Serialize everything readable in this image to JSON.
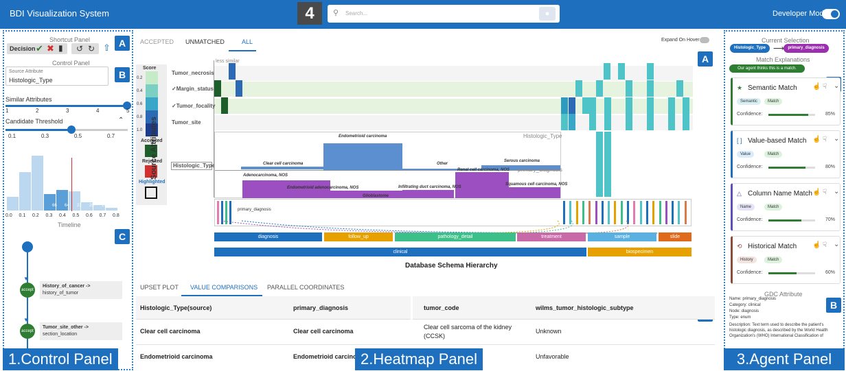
{
  "header": {
    "title": "BDI Visualization System",
    "marker": "4",
    "search_placeholder": "Search...",
    "developer_mode": "Developer Mode"
  },
  "panel_labels": {
    "control": "1.Control Panel",
    "heatmap": "2.Heatmap Panel",
    "agent": "3.Agent Panel"
  },
  "badges": {
    "a": "A",
    "b": "B",
    "c": "C"
  },
  "control": {
    "shortcut_title": "Shortcut Panel",
    "decision": "Decision",
    "control_title": "Control Panel",
    "source_attr_label": "Source Attribute",
    "source_attr_value": "Histologic_Type",
    "similar_label": "Similar Attributes",
    "similar_ticks": [
      "1",
      "2",
      "3",
      "4",
      "5"
    ],
    "threshold_label": "Candidate Threshold",
    "threshold_ticks": [
      "0.1",
      "0.3",
      "0.5",
      "0.7"
    ],
    "hist_values": [
      "66",
      "64",
      "21",
      "25",
      "17"
    ],
    "hist_axis": [
      "0.0",
      "0.1",
      "0.2",
      "0.3",
      "0.4",
      "0.5",
      "0.6",
      "0.7",
      "0.8"
    ],
    "timeline_label": "Timeline",
    "timeline": [
      {
        "badge": "accept",
        "title": "History_of_cancer ->",
        "sub": "history_of_tumor"
      },
      {
        "badge": "accept",
        "title": "Tumor_site_other ->",
        "sub": "section_location"
      }
    ]
  },
  "heatmap": {
    "tabs": [
      "ACCEPTED",
      "UNMATCHED",
      "ALL"
    ],
    "active_tab": "ALL",
    "expand_label": "Expand On Hover",
    "legend": {
      "score": "Score",
      "ticks": [
        "0.2",
        "0.4",
        "0.6",
        "0.8",
        "1.0"
      ],
      "accepted": "Accepted",
      "rejected": "Rejected",
      "highlighted": "Highlighted",
      "accent": "#1e5e2a",
      "reject": "#d32f2f"
    },
    "y_title": "Source Attributes",
    "less_similar": "less similar",
    "rows": [
      "Tumor_necrosis",
      "✓Margin_status",
      "✓Tumor_focality",
      "Tumor_site"
    ],
    "hist_row": "Histologic_Type",
    "dist_labels": [
      "Endometrioid carcinoma",
      "Clear cell carcinoma",
      "Other",
      "Serous carcinoma",
      "Histologic_Type",
      "Renal cell carcinoma, NOS",
      "primary_diagnosis",
      "Adenocarcinoma, NOS",
      "Endometrioid adenocarcinoma, NOS",
      "Glioblastome",
      "Infiltrating duct carcinoma, NOS",
      "Squamous cell carcinoma, NOS"
    ],
    "primary_label": "primary_diagnosis",
    "hierarchy_l1": [
      "diagnosis",
      "follow_up",
      "pathology_detail",
      "treatment",
      "sample",
      "slide"
    ],
    "hierarchy_l2": [
      "clinical",
      "biospecimen"
    ],
    "hierarchy_title": "Database Schema Hierarchy"
  },
  "lower": {
    "tabs": [
      "UPSET PLOT",
      "VALUE COMPARISONS",
      "PARALLEL COORDINATES"
    ],
    "columns": [
      "Histologic_Type(source)",
      "primary_diagnosis",
      "tumor_code",
      "wilms_tumor_histologic_subtype"
    ],
    "rows": [
      [
        "Clear cell carcinoma",
        "Clear cell carcinoma",
        "Clear cell sarcoma of the kidney (CCSK)",
        "Unknown"
      ],
      [
        "Endometrioid carcinoma",
        "Endometrioid carcinoma",
        "",
        "Unfavorable"
      ]
    ]
  },
  "agent": {
    "current_title": "Current Selection",
    "source_chip": "Histologic_Type",
    "target_chip": "primary_diagnosis",
    "explanations_title": "Match Explanations",
    "agent_msg": "Our agent thinks this is a match.",
    "cards": [
      {
        "title": "Semantic Match",
        "tags": [
          "Semantic",
          "Match"
        ],
        "confidence": "Confidence:",
        "pct": "85%",
        "value": 0.85,
        "color": "#2e7d32"
      },
      {
        "title": "Value-based Match",
        "tags": [
          "Value",
          "Match"
        ],
        "confidence": "Confidence:",
        "pct": "80%",
        "value": 0.8,
        "color": "#1f6fbf"
      },
      {
        "title": "Column Name Match",
        "tags": [
          "Name",
          "Match"
        ],
        "confidence": "Confidence:",
        "pct": "70%",
        "value": 0.7,
        "color": "#5c4fb8"
      },
      {
        "title": "Historical Match",
        "tags": [
          "History",
          "Match"
        ],
        "confidence": "Confidence:",
        "pct": "60%",
        "value": 0.6,
        "color": "#8d4b3a"
      }
    ],
    "gdc_title": "GDC Attribute",
    "gdc": {
      "name": "Name: primary_diagnosis",
      "category": "Category: clinical",
      "node": "Node: diagnosis",
      "type": "Type: enum",
      "desc": "Description: Text term used to describe the patient's histologic diagnosis, as described by the World Health Organization's (WHO) International Classification of"
    }
  }
}
